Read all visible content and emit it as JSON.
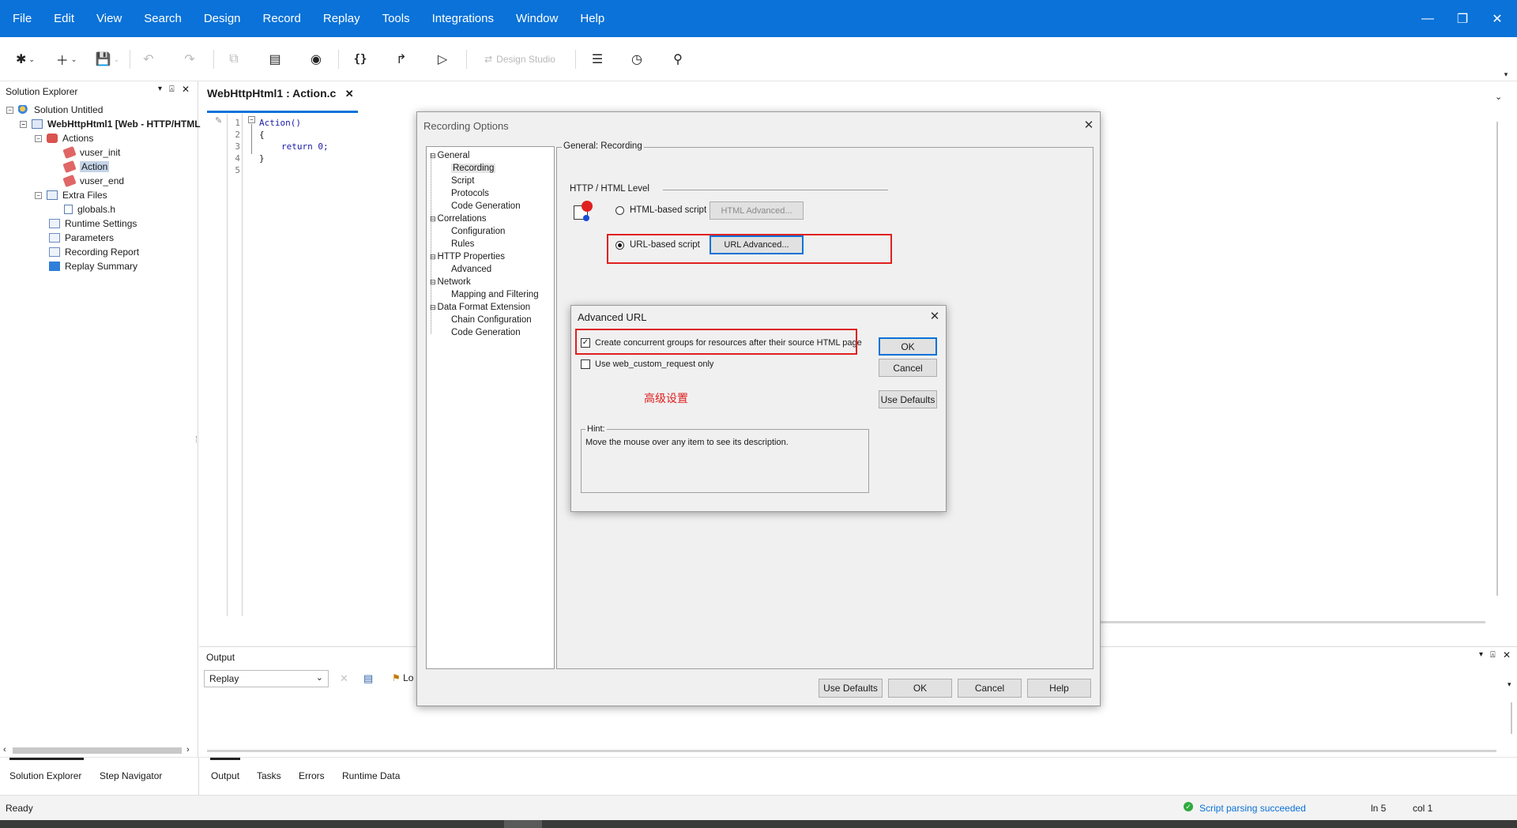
{
  "menubar": {
    "items": [
      "File",
      "Edit",
      "View",
      "Search",
      "Design",
      "Record",
      "Replay",
      "Tools",
      "Integrations",
      "Window",
      "Help"
    ]
  },
  "toolbar": {
    "design_studio_label": "Design Studio"
  },
  "solution_explorer": {
    "title": "Solution Explorer",
    "tree": [
      {
        "label": "Solution Untitled",
        "icon": "solution-icon"
      },
      {
        "label": "WebHttpHtml1 [Web - HTTP/HTML",
        "icon": "script-icon"
      },
      {
        "label": "Actions",
        "icon": "actions-icon"
      },
      {
        "label": "vuser_init",
        "icon": "action-icon"
      },
      {
        "label": "Action",
        "icon": "action-icon"
      },
      {
        "label": "vuser_end",
        "icon": "action-icon"
      },
      {
        "label": "Extra Files",
        "icon": "folder-icon"
      },
      {
        "label": "globals.h",
        "icon": "file-icon"
      },
      {
        "label": "Runtime Settings",
        "icon": "settings-icon"
      },
      {
        "label": "Parameters",
        "icon": "parameters-icon"
      },
      {
        "label": "Recording Report",
        "icon": "report-icon"
      },
      {
        "label": "Replay Summary",
        "icon": "replay-icon"
      }
    ]
  },
  "editor": {
    "tab_title": "WebHttpHtml1 : Action.c",
    "line_numbers": [
      "1",
      "2",
      "3",
      "4",
      "5"
    ],
    "code_lines": [
      "Action()",
      "{",
      "return 0;",
      "}"
    ]
  },
  "output": {
    "title": "Output",
    "dropdown_value": "Replay",
    "lo_label": "Lo"
  },
  "bottom_tabs_left": [
    "Solution Explorer",
    "Step Navigator"
  ],
  "bottom_tabs_right": [
    "Output",
    "Tasks",
    "Errors",
    "Runtime Data"
  ],
  "status": {
    "ready": "Ready",
    "parse_message": "Script parsing succeeded",
    "line": "ln 5",
    "col": "col 1"
  },
  "recording_options": {
    "title": "Recording Options",
    "tree": [
      {
        "label": "General",
        "level": 0
      },
      {
        "label": "Recording",
        "level": 1
      },
      {
        "label": "Script",
        "level": 1
      },
      {
        "label": "Protocols",
        "level": 1
      },
      {
        "label": "Code Generation",
        "level": 1
      },
      {
        "label": "Correlations",
        "level": 0
      },
      {
        "label": "Configuration",
        "level": 1
      },
      {
        "label": "Rules",
        "level": 1
      },
      {
        "label": "HTTP Properties",
        "level": 0
      },
      {
        "label": "Advanced",
        "level": 1
      },
      {
        "label": "Network",
        "level": 0
      },
      {
        "label": "Mapping and Filtering",
        "level": 1
      },
      {
        "label": "Data Format Extension",
        "level": 0
      },
      {
        "label": "Chain Configuration",
        "level": 1
      },
      {
        "label": "Code Generation",
        "level": 1
      }
    ],
    "group_title": "General: Recording",
    "level_label": "HTTP / HTML Level",
    "html_based_label": "HTML-based script",
    "html_advanced_label": "HTML Advanced...",
    "url_based_label": "URL-based script",
    "url_advanced_label": "URL Advanced...",
    "buttons": {
      "use_defaults": "Use Defaults",
      "ok": "OK",
      "cancel": "Cancel",
      "help": "Help"
    }
  },
  "advanced_url": {
    "title": "Advanced URL",
    "concurrent_label": "Create concurrent groups for resources after their source HTML page",
    "concurrent_checked": true,
    "custom_request_label": "Use web_custom_request only",
    "custom_request_checked": false,
    "annotation": "高级设置",
    "hint_title": "Hint:",
    "hint_text": "Move the mouse over any item to see its description.",
    "buttons": {
      "ok": "OK",
      "cancel": "Cancel",
      "use_defaults": "Use Defaults"
    }
  },
  "colors": {
    "menubar": "#0a72d8",
    "annotation_red": "#e02020",
    "success_green": "#2eaa3f"
  }
}
